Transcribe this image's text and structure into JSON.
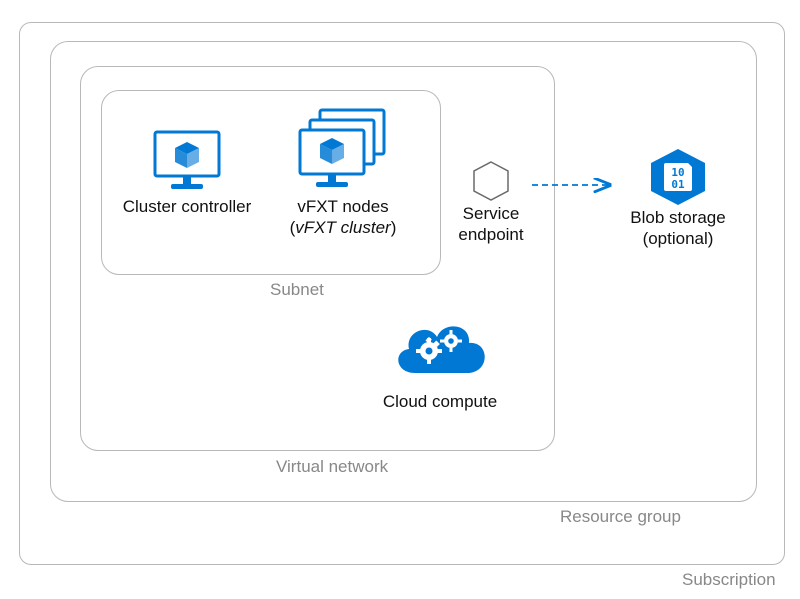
{
  "colors": {
    "azure_blue": "#0078D4",
    "border_gray": "#b8b8b8",
    "label_gray": "#888888",
    "text": "#111111",
    "white": "#ffffff"
  },
  "containers": {
    "subscription": {
      "label": "Subscription"
    },
    "resource_group": {
      "label": "Resource group"
    },
    "vnet": {
      "label": "Virtual network"
    },
    "subnet": {
      "label": "Subnet"
    }
  },
  "nodes": {
    "cluster_controller": {
      "line1": "Cluster controller"
    },
    "vfxt_nodes": {
      "line1": "vFXT nodes",
      "line2_prefix": "(",
      "line2_italic": "vFXT cluster",
      "line2_suffix": ")"
    },
    "service_endpoint": {
      "line1": "Service",
      "line2": "endpoint"
    },
    "blob_storage": {
      "line1": "Blob storage",
      "line2": "(optional)"
    },
    "cloud_compute": {
      "line1": "Cloud compute"
    }
  },
  "icons": {
    "monitor": "monitor-cube-icon",
    "monitors_stack": "monitors-stack-cube-icon",
    "hexagon": "hexagon-icon",
    "blob": "blob-storage-icon",
    "cloud": "cloud-gears-icon"
  }
}
